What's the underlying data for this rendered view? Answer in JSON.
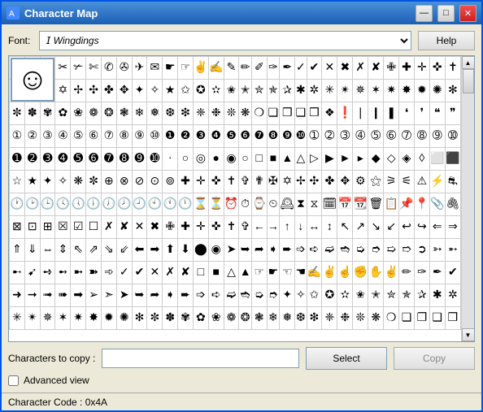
{
  "window": {
    "title": "Character Map",
    "icon": "🗺"
  },
  "title_buttons": {
    "minimize": "—",
    "maximize": "□",
    "close": "✕"
  },
  "font_section": {
    "label": "Font:",
    "value": "Wingdings",
    "help_label": "Help"
  },
  "bottom": {
    "copy_label": "Characters to copy :",
    "copy_value": "",
    "select_label": "Select",
    "copy_btn_label": "Copy"
  },
  "advanced": {
    "label": "Advanced view"
  },
  "status": {
    "text": "Character Code : 0x4A"
  },
  "colors": {
    "accent": "#316ac5",
    "border": "#7f9db9"
  }
}
